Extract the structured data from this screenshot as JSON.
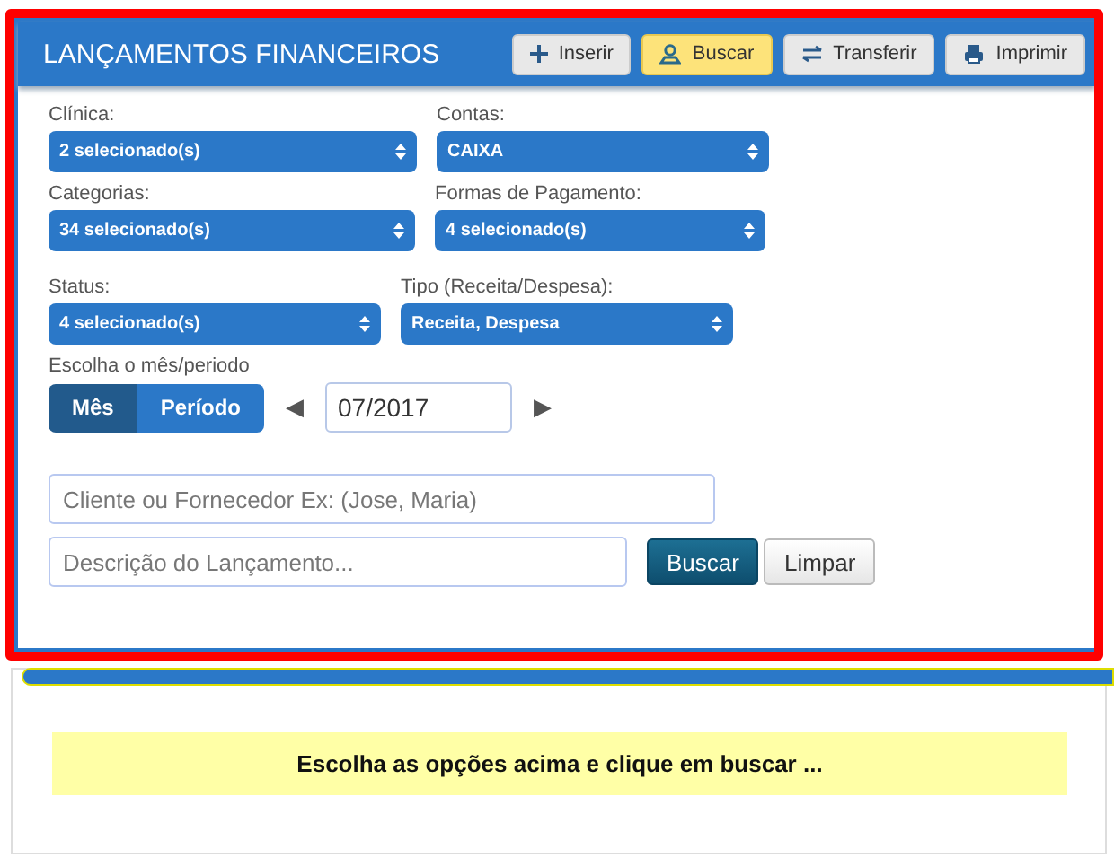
{
  "panel": {
    "title": "LANÇAMENTOS FINANCEIROS",
    "actions": [
      {
        "label": "Inserir",
        "kind": "plus",
        "highlighted": false
      },
      {
        "label": "Buscar",
        "kind": "person",
        "highlighted": true
      },
      {
        "label": "Transferir",
        "kind": "arrows",
        "highlighted": false
      },
      {
        "label": "Imprimir",
        "kind": "printer",
        "highlighted": false
      }
    ]
  },
  "filter_rows": [
    [
      {
        "label": "Clínica:",
        "value": "2 selecionado(s)"
      },
      {
        "label": "Contas:",
        "value": "CAIXA"
      }
    ],
    [
      {
        "label": "Categorias:",
        "value": "34 selecionado(s)"
      },
      {
        "label": "Formas de Pagamento:",
        "value": "4 selecionado(s)"
      }
    ],
    [
      {
        "label": "Status:",
        "value": "4 selecionado(s)"
      },
      {
        "label": "Tipo (Receita/Despesa):",
        "value": "Receita, Despesa"
      }
    ]
  ],
  "period": {
    "label": "Escolha o mês/periodo",
    "modes": [
      {
        "label": "Mês",
        "selected": true
      },
      {
        "label": "Período",
        "selected": false
      }
    ],
    "prev": "◀",
    "value": "07/2017",
    "next": "▶"
  },
  "client_field": {
    "placeholder": "Cliente ou Fornecedor Ex: (Jose, Maria)"
  },
  "description_field": {
    "placeholder": "Descrição do Lançamento..."
  },
  "buttons": [
    {
      "label": "Buscar",
      "kind": "primary"
    },
    {
      "label": "Limpar",
      "kind": "default"
    }
  ],
  "message": "Escolha as opções acima e clique em buscar ..."
}
